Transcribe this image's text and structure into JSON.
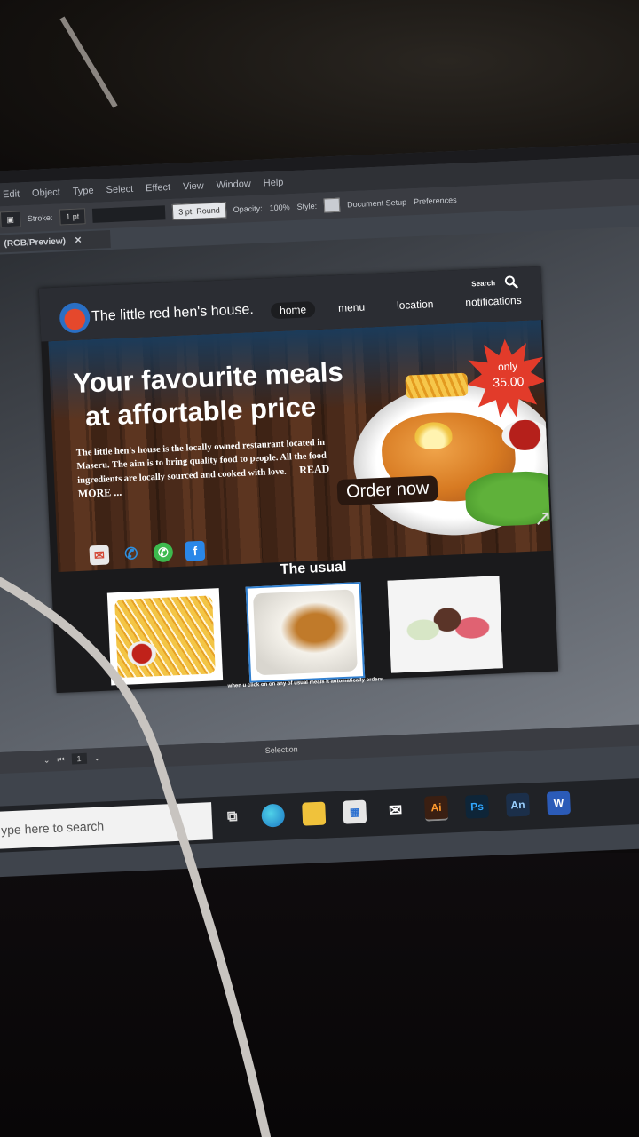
{
  "app": {
    "menu": [
      "Edit",
      "Object",
      "Type",
      "Select",
      "Effect",
      "View",
      "Window",
      "Help"
    ],
    "control_bar": {
      "stroke_label": "Stroke:",
      "stroke_value": "1 pt",
      "brush_value": "3 pt. Round",
      "opacity_label": "Opacity:",
      "opacity_value": "100%",
      "style_label": "Style:",
      "document_setup": "Document Setup",
      "preferences": "Preferences"
    },
    "doc_tab": "(RGB/Preview)",
    "tool_label": "Selection",
    "page_number": "1"
  },
  "site": {
    "logo_text": "The little red hen's house.",
    "search_label": "Search",
    "nav": [
      "home",
      "menu",
      "location",
      "notifications"
    ],
    "headline_line1": "Your favourite meals",
    "headline_line2": "at affortable price",
    "blurb": "The little hen's house is the locally owned restaurant located in Maseru. The aim is to bring quality food to people. All the food ingredients are locally sourced and cooked with love.",
    "read_more": "READ MORE ...",
    "price_only": "only",
    "price_value": "35.00",
    "order_button": "Order now",
    "usual_title": "The usual",
    "caption": "when u click on on any of usual meals it automatically orders...",
    "usual_items": [
      "fries",
      "stew",
      "milkshakes"
    ]
  },
  "taskbar": {
    "search_placeholder": "ype here to search",
    "apps": [
      "Ai",
      "Ps",
      "An",
      "W"
    ]
  },
  "colors": {
    "accent_red": "#e23b2a",
    "header_bg": "#2b2d33",
    "facebook": "#2a87e8",
    "whatsapp": "#3dba4e"
  }
}
